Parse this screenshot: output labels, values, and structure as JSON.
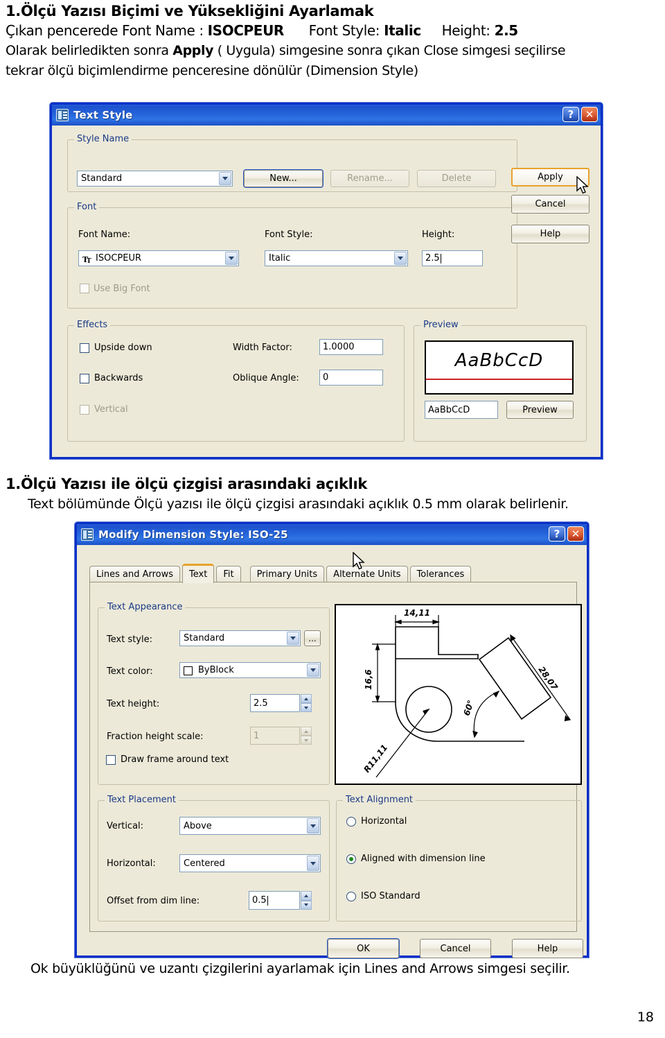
{
  "document": {
    "heading1": "1.Ölçü Yazısı Biçimi ve Yüksekliğini Ayarlamak",
    "line2_prefix": "Çıkan pencerede Font Name : ",
    "line2_b1": "ISOCPEUR",
    "line2_mid": "Font Style: ",
    "line2_b2": "Italic",
    "line2_mid2": "Height: ",
    "line2_b3": "2.5",
    "line3_a": "Olarak belirledikten sonra ",
    "line3_b": "Apply",
    "line3_c": " ( Uygula) simgesine sonra çıkan Close simgesi seçilirse",
    "line4": "tekrar ölçü biçimlendirme penceresine dönülür (Dimension Style)",
    "heading2": "1.Ölçü Yazısı ile ölçü çizgisi arasındaki açıklık",
    "mid_line": "Text bölümünde  Ölçü yazısı ile ölçü çizgisi arasındaki açıklık 0.5 mm olarak belirlenir.",
    "footer_line": "Ok büyüklüğünü ve uzantı çizgilerini ayarlamak için Lines and Arrows simgesi seçilir.",
    "page_number": "18"
  },
  "text_style_dialog": {
    "title": "Text Style",
    "title_icon": "text-style-icon",
    "help_button": "?",
    "close_button": "✕",
    "style_name": {
      "group_label": "Style Name",
      "combo_value": "Standard",
      "new_button": "New...",
      "rename_button": "Rename...",
      "delete_button": "Delete"
    },
    "font": {
      "group_label": "Font",
      "font_name_label": "Font Name:",
      "font_name_value": "ISOCPEUR",
      "font_name_icon": "truetype-icon",
      "font_style_label": "Font Style:",
      "font_style_value": "Italic",
      "height_label": "Height:",
      "height_value": "2.5",
      "use_big_font_label": "Use Big Font"
    },
    "effects": {
      "group_label": "Effects",
      "upside_down_label": "Upside down",
      "backwards_label": "Backwards",
      "vertical_label": "Vertical",
      "width_factor_label": "Width Factor:",
      "width_factor_value": "1.0000",
      "oblique_angle_label": "Oblique Angle:",
      "oblique_angle_value": "0"
    },
    "preview": {
      "group_label": "Preview",
      "sample_text": "AaBbCcD",
      "input_value": "AaBbCcD",
      "preview_button": "Preview"
    },
    "side_buttons": {
      "apply": "Apply",
      "cancel": "Cancel",
      "help": "Help"
    }
  },
  "dimension_style_dialog": {
    "title": "Modify Dimension Style: ISO-25",
    "title_icon": "dimension-style-icon",
    "help_button": "?",
    "close_button": "✕",
    "tabs": [
      {
        "label": "Lines and Arrows",
        "active": false
      },
      {
        "label": "Text",
        "active": true
      },
      {
        "label": "Fit",
        "active": false
      },
      {
        "label": "Primary Units",
        "active": false
      },
      {
        "label": "Alternate Units",
        "active": false
      },
      {
        "label": "Tolerances",
        "active": false
      }
    ],
    "text_appearance": {
      "group_label": "Text Appearance",
      "text_style_label": "Text style:",
      "text_style_value": "Standard",
      "browse_button": "...",
      "text_color_label": "Text color:",
      "text_color_value": "ByBlock",
      "text_height_label": "Text height:",
      "text_height_value": "2.5",
      "fraction_height_label": "Fraction height scale:",
      "fraction_height_value": "1",
      "draw_frame_label": "Draw frame around text"
    },
    "text_placement": {
      "group_label": "Text Placement",
      "vertical_label": "Vertical:",
      "vertical_value": "Above",
      "horizontal_label": "Horizontal:",
      "horizontal_value": "Centered",
      "offset_label": "Offset from dim line:",
      "offset_value": "0.5"
    },
    "text_alignment": {
      "group_label": "Text Alignment",
      "option_horizontal": "Horizontal",
      "option_aligned": "Aligned with dimension line",
      "option_iso": "ISO Standard",
      "selected": "Aligned with dimension line"
    },
    "preview_drawing": {
      "dim_top": "14,11",
      "dim_left": "16,6",
      "dim_right": "28,07",
      "dim_angle": "60°",
      "dim_radius": "R11,11"
    },
    "buttons": {
      "ok": "OK",
      "cancel": "Cancel",
      "help": "Help"
    }
  },
  "colors": {
    "title_blue": "#1d52ce",
    "dialog_face": "#ece9d8",
    "group_title": "#1b3a87",
    "accent_orange": "#e8a22b",
    "preview_rule_red": "#cc2222"
  }
}
